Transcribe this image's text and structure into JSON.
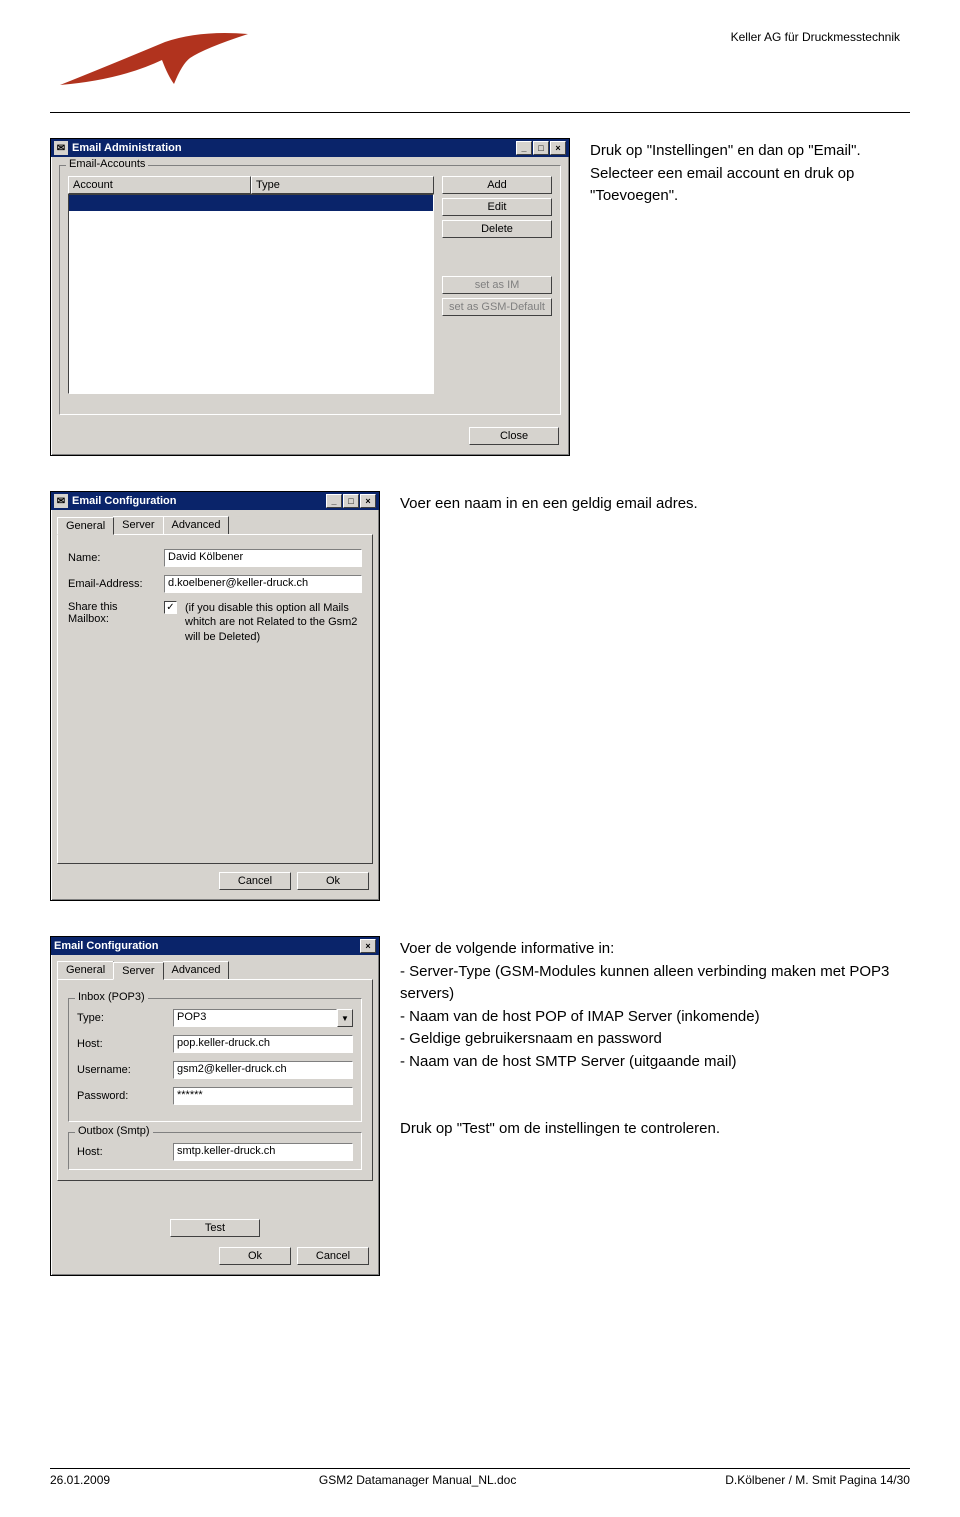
{
  "header": {
    "brand": "Keller AG für Druckmesstechnik"
  },
  "section1": {
    "text": "Druk op \"Instellingen\" en dan op \"Email\". Selecteer een email account en druk op \"Toevoegen\".",
    "win_title": "Email Administration",
    "group_title": "Email-Accounts",
    "col_account": "Account",
    "col_type": "Type",
    "btn_add": "Add",
    "btn_edit": "Edit",
    "btn_delete": "Delete",
    "btn_set1": "set as IM",
    "btn_set2": "set as GSM-Default",
    "btn_close": "Close"
  },
  "section2": {
    "text": "Voer een naam in en een geldig email adres.",
    "win_title": "Email Configuration",
    "tab_general": "General",
    "tab_server": "Server",
    "tab_advanced": "Advanced",
    "lbl_name": "Name:",
    "val_name": "David Kölbener",
    "lbl_email": "Email-Address:",
    "val_email": "d.koelbener@keller-druck.ch",
    "lbl_share": "Share this Mailbox:",
    "share_note": "(if you disable this option all Mails whitch are not Related to the Gsm2 will be Deleted)",
    "btn_cancel": "Cancel",
    "btn_ok": "Ok"
  },
  "section3": {
    "text1": "Voer de volgende informative in:",
    "bul1": "- Server-Type (GSM-Modules kunnen alleen verbinding maken met POP3 servers)",
    "bul2": "- Naam van de host POP of IMAP Server (inkomende)",
    "bul3": "- Geldige gebruikersnaam en password",
    "bul4": "- Naam van de host SMTP Server (uitgaande mail)",
    "text2": "Druk op \"Test\" om de instellingen te controleren.",
    "win_title": "Email Configuration",
    "tab_general": "General",
    "tab_server": "Server",
    "tab_advanced": "Advanced",
    "group_inbox": "Inbox (POP3)",
    "lbl_type": "Type:",
    "val_type": "POP3",
    "lbl_host_in": "Host:",
    "val_host_in": "pop.keller-druck.ch",
    "lbl_user": "Username:",
    "val_user": "gsm2@keller-druck.ch",
    "lbl_pass": "Password:",
    "val_pass": "******",
    "group_outbox": "Outbox (Smtp)",
    "lbl_host_out": "Host:",
    "val_host_out": "smtp.keller-druck.ch",
    "btn_test": "Test",
    "btn_ok": "Ok",
    "btn_cancel": "Cancel"
  },
  "footer": {
    "date": "26.01.2009",
    "doc": "GSM2 Datamanager Manual_NL.doc",
    "page": "D.Kölbener / M. Smit Pagina 14/30"
  }
}
